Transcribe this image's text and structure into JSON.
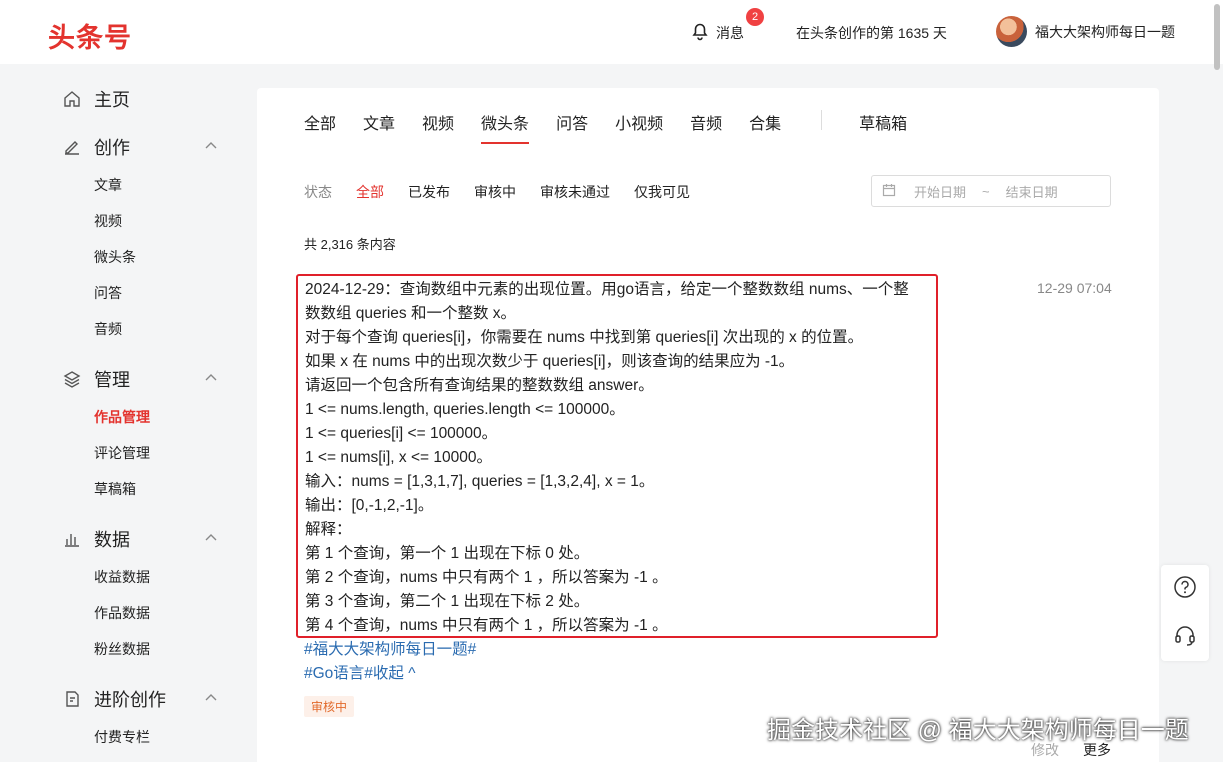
{
  "header": {
    "logo": "头条号",
    "notif_label": "消息",
    "notif_count": "2",
    "days_text": "在头条创作的第 1635 天",
    "username": "福大大架构师每日一题"
  },
  "sidebar": {
    "home": "主页",
    "create": "创作",
    "create_items": [
      "文章",
      "视频",
      "微头条",
      "问答",
      "音频"
    ],
    "manage": "管理",
    "manage_items": [
      "作品管理",
      "评论管理",
      "草稿箱"
    ],
    "data": "数据",
    "data_items": [
      "收益数据",
      "作品数据",
      "粉丝数据"
    ],
    "advanced": "进阶创作",
    "advanced_items": [
      "付费专栏"
    ]
  },
  "tabs": [
    "全部",
    "文章",
    "视频",
    "微头条",
    "问答",
    "小视频",
    "音频",
    "合集",
    "草稿箱"
  ],
  "active_tab": "微头条",
  "filters": {
    "label": "状态",
    "items": [
      "全部",
      "已发布",
      "审核中",
      "审核未通过",
      "仅我可见"
    ],
    "active": "全部"
  },
  "date_range": {
    "start": "开始日期",
    "separator": "~",
    "end": "结束日期"
  },
  "total": "共 2,316 条内容",
  "post": {
    "lines": [
      "2024-12-29：查询数组中元素的出现位置。用go语言，给定一个整数数组 nums、一个整",
      "数数组 queries 和一个整数 x。",
      "对于每个查询 queries[i]，你需要在 nums 中找到第 queries[i] 次出现的 x 的位置。",
      "如果 x 在 nums 中的出现次数少于 queries[i]，则该查询的结果应为 -1。",
      "请返回一个包含所有查询结果的整数数组 answer。",
      "1 <= nums.length, queries.length <= 100000。",
      "1 <= queries[i] <= 100000。",
      "1 <= nums[i], x <= 10000。",
      "输入：nums = [1,3,1,7], queries = [1,3,2,4], x = 1。",
      "输出：[0,-1,2,-1]。",
      "解释：",
      "第 1 个查询，第一个 1 出现在下标 0 处。",
      "第 2 个查询，nums 中只有两个 1 ，所以答案为 -1 。",
      "第 3 个查询，第二个 1 出现在下标 2 处。",
      "第 4 个查询，nums 中只有两个 1 ，所以答案为 -1 。"
    ],
    "tag1": "#福大大架构师每日一题#",
    "tag2": "#Go语言#收起 ^",
    "time": "12-29 07:04",
    "status": "审核中",
    "edit": "修改",
    "more": "更多"
  },
  "watermark": "掘金技术社区 @ 福大大架构师每日一题"
}
